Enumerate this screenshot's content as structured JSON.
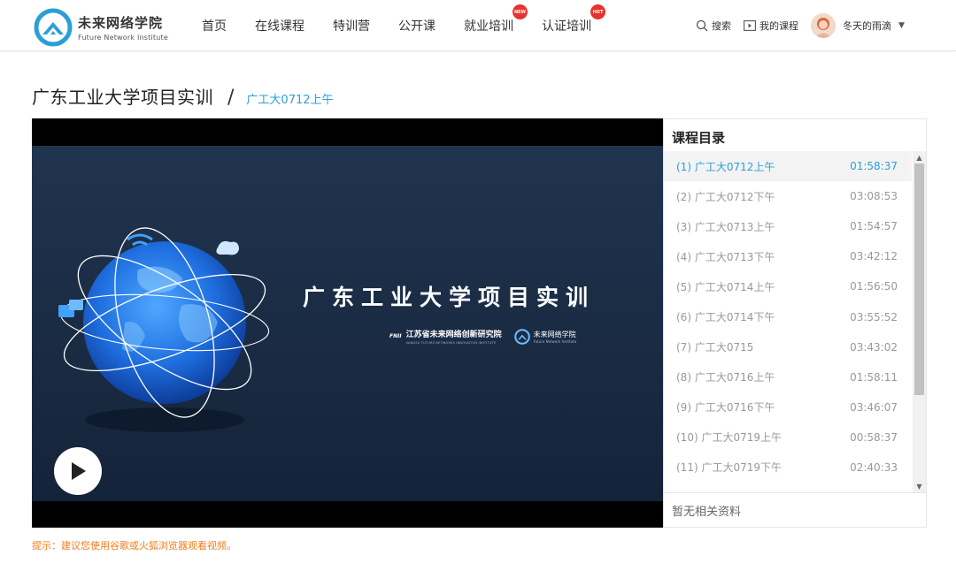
{
  "brand": {
    "name_cn": "未来网络学院",
    "name_en": "Future Network Institute",
    "color": "#2a9fd8"
  },
  "nav": {
    "items": [
      {
        "label": "首页"
      },
      {
        "label": "在线课程"
      },
      {
        "label": "特训营"
      },
      {
        "label": "公开课"
      },
      {
        "label": "就业培训",
        "badge": "NEW"
      },
      {
        "label": "认证培训",
        "badge": "HOT"
      }
    ]
  },
  "toolbar": {
    "search_label": "搜索",
    "my_courses_label": "我的课程",
    "username": "冬天的雨滴",
    "caret": "▼"
  },
  "page": {
    "course_title": "广东工业大学项目实训",
    "separator": "/",
    "lesson_title": "广工大0712上午"
  },
  "slide": {
    "title": "广东工业大学项目实训",
    "org_mark": "FNII",
    "org_name": "江苏省未来网络创新研究院",
    "org_sub": "JIANGSU FUTURE NETWORKS INNOVATION INSTITUTE",
    "brand_cn": "未来网络学院",
    "brand_en": "Future Network Institute"
  },
  "catalog": {
    "title": "课程目录",
    "items": [
      {
        "index": "(1)",
        "name": "广工大0712上午",
        "duration": "01:58:37",
        "active": true
      },
      {
        "index": "(2)",
        "name": "广工大0712下午",
        "duration": "03:08:53"
      },
      {
        "index": "(3)",
        "name": "广工大0713上午",
        "duration": "01:54:57"
      },
      {
        "index": "(4)",
        "name": "广工大0713下午",
        "duration": "03:42:12"
      },
      {
        "index": "(5)",
        "name": "广工大0714上午",
        "duration": "01:56:50"
      },
      {
        "index": "(6)",
        "name": "广工大0714下午",
        "duration": "03:55:52"
      },
      {
        "index": "(7)",
        "name": "广工大0715",
        "duration": "03:43:02"
      },
      {
        "index": "(8)",
        "name": "广工大0716上午",
        "duration": "01:58:11"
      },
      {
        "index": "(9)",
        "name": "广工大0716下午",
        "duration": "03:46:07"
      },
      {
        "index": "(10)",
        "name": "广工大0719上午",
        "duration": "00:58:37"
      },
      {
        "index": "(11)",
        "name": "广工大0719下午",
        "duration": "02:40:33"
      }
    ],
    "no_material": "暂无相关资料"
  },
  "tip": "提示：建议您使用谷歌或火狐浏览器观看视频。",
  "colors": {
    "accent": "#2a9fd8",
    "tip": "#f07d1f",
    "badge": "#e8322d"
  }
}
